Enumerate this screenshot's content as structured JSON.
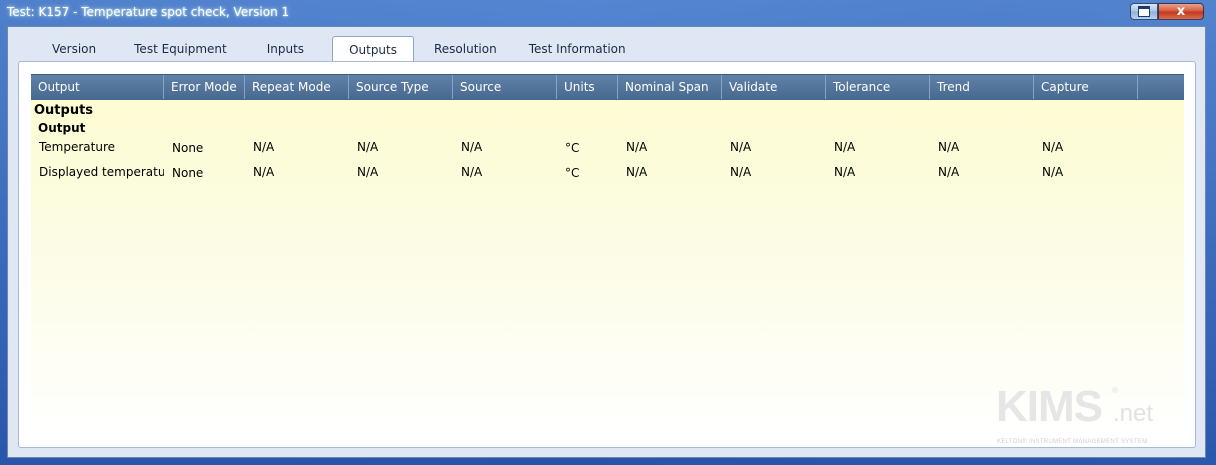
{
  "window": {
    "title": "Test: K157 - Temperature spot check, Version 1",
    "close_glyph": "x"
  },
  "tabs": [
    {
      "label": "Version"
    },
    {
      "label": "Test Equipment"
    },
    {
      "label": "Inputs"
    },
    {
      "label": "Outputs"
    },
    {
      "label": "Resolution"
    },
    {
      "label": "Test Information"
    }
  ],
  "active_tab": "Outputs",
  "table": {
    "columns": [
      "Output",
      "Error Mode",
      "Repeat Mode",
      "Source Type",
      "Source",
      "Units",
      "Nominal Span",
      "Validate",
      "Tolerance",
      "Trend",
      "Capture"
    ],
    "group_title": "Outputs",
    "subgroup_title": "Output",
    "rows": [
      [
        "Temperature",
        "None",
        "N/A",
        "N/A",
        "N/A",
        "°C",
        "N/A",
        "N/A",
        "N/A",
        "N/A",
        "N/A"
      ],
      [
        "Displayed temperature",
        "None",
        "N/A",
        "N/A",
        "N/A",
        "°C",
        "N/A",
        "N/A",
        "N/A",
        "N/A",
        "N/A"
      ]
    ]
  },
  "logo": {
    "main": "KIMS",
    "suffix": ".net",
    "reg": "®",
    "tagline": "KELTON® INSTRUMENT MANAGEMENT SYSTEM"
  },
  "colors": {
    "header_bg": "#52739b",
    "grid_bg_top": "#fdfccf",
    "accent": "#1e4794"
  }
}
